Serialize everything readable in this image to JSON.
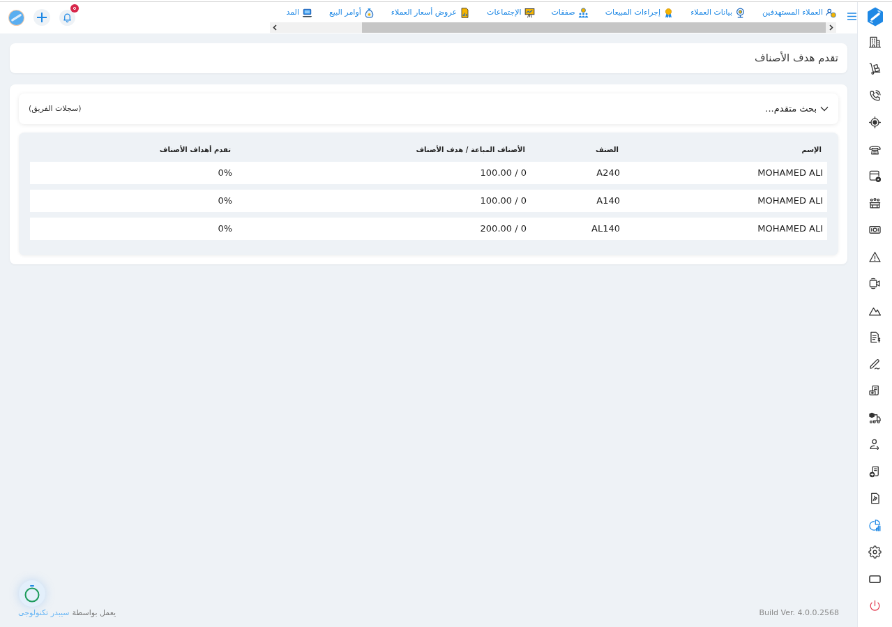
{
  "sidebar": {
    "items": [
      {
        "selected": false
      },
      {
        "selected": false
      },
      {
        "selected": false
      },
      {
        "selected": false
      },
      {
        "selected": false
      },
      {
        "selected": false
      },
      {
        "selected": false
      },
      {
        "selected": false
      },
      {
        "selected": false
      },
      {
        "selected": false
      },
      {
        "selected": false
      },
      {
        "selected": false
      },
      {
        "selected": false
      },
      {
        "selected": false
      },
      {
        "selected": false
      },
      {
        "selected": false
      },
      {
        "selected": false
      },
      {
        "selected": false
      },
      {
        "selected": true
      },
      {
        "selected": false
      },
      {
        "selected": false
      },
      {
        "selected": false
      }
    ]
  },
  "header": {
    "nav_items": [
      {
        "label": "العملاء المستهدفين"
      },
      {
        "label": "بيانات العملاء"
      },
      {
        "label": "إجراءات المبيعات"
      },
      {
        "label": "صفقات"
      },
      {
        "label": "الإجتماعات"
      },
      {
        "label": "عروض أسعار العملاء"
      },
      {
        "label": "أوامر البيع"
      },
      {
        "label": "المد"
      }
    ],
    "notifications": {
      "badge": true
    }
  },
  "page": {
    "title": "تقدم هدف الأصناف"
  },
  "search": {
    "label": "بحث متقدم...",
    "expanded": false,
    "scope": "(سجلات الفريق)"
  },
  "table": {
    "columns": [
      "الإسم",
      "الصنف",
      "الأصناف المباعة / هدف الأصناف",
      "تقدم أهداف الأصناف"
    ],
    "rows": [
      [
        "MOHAMED ALI",
        "A240",
        "0 / 100.00",
        "0%"
      ],
      [
        "MOHAMED ALI",
        "A140",
        "0 / 100.00",
        "0%"
      ],
      [
        "MOHAMED ALI",
        "AL140",
        "0 / 200.00",
        "0%"
      ]
    ]
  },
  "footer": {
    "build": "Build Ver. 4.0.0.2568",
    "powered_by": "يعمل بواسطة",
    "company": "سيبدر تكنولوجى"
  }
}
